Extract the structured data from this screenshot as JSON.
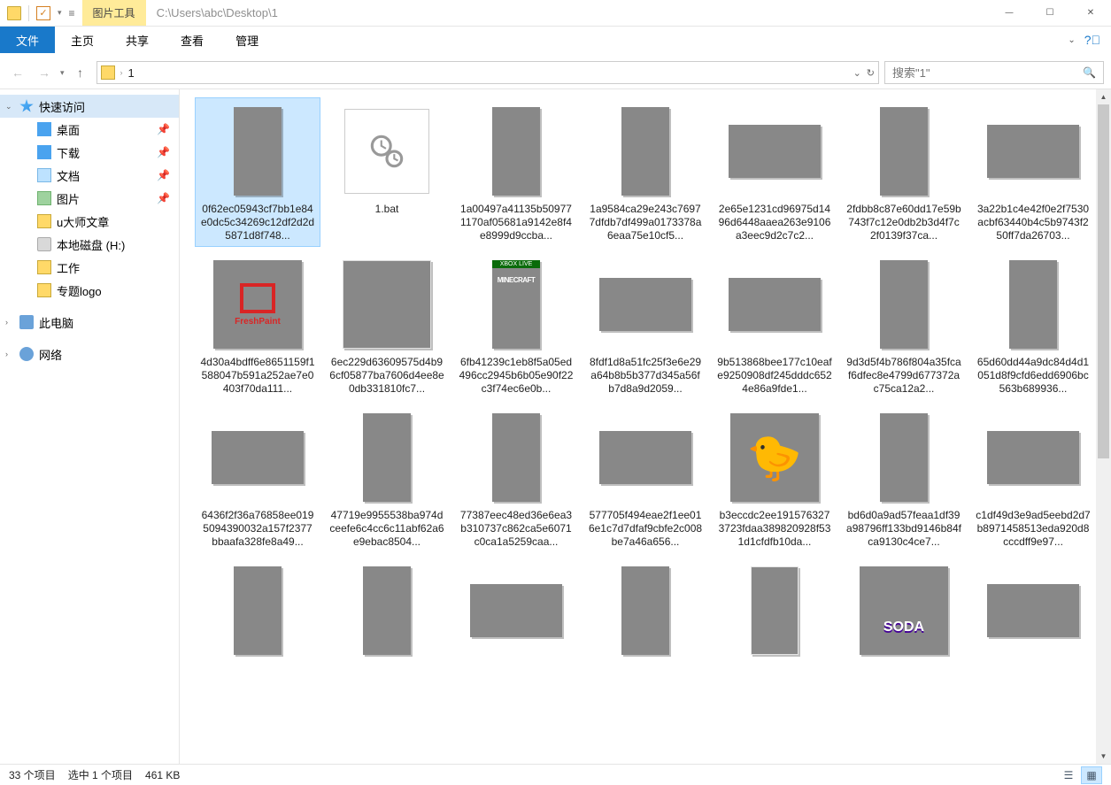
{
  "title_path": "C:\\Users\\abc\\Desktop\\1",
  "context_tab": "图片工具",
  "ribbon": {
    "file": "文件",
    "home": "主页",
    "share": "共享",
    "view": "查看",
    "manage": "管理"
  },
  "breadcrumb": {
    "folder": "1"
  },
  "search": {
    "placeholder": "搜索\"1\""
  },
  "sidebar": {
    "quick": "快速访问",
    "desktop": "桌面",
    "downloads": "下载",
    "documents": "文档",
    "pictures": "图片",
    "udashi": "u大师文章",
    "drive": "本地磁盘 (H:)",
    "work": "工作",
    "logo": "专题logo",
    "pc": "此电脑",
    "network": "网络"
  },
  "items": [
    {
      "name": "0f62ec05943cf7bb1e84e0dc5c34269c12df2d2d5871d8f748...",
      "cls": "g1",
      "shape": "tall",
      "sel": true
    },
    {
      "name": "1.bat",
      "cls": "bat",
      "shape": "bat"
    },
    {
      "name": "1a00497a41135b509771170af05681a9142e8f4e8999d9ccba...",
      "cls": "g2",
      "shape": "tall"
    },
    {
      "name": "1a9584ca29e243c76977dfdb7df499a0173378a6eaa75e10cf5...",
      "cls": "g3",
      "shape": "tall"
    },
    {
      "name": "2e65e1231cd96975d1496d6448aaea263e9106a3eec9d2c7c2...",
      "cls": "g4",
      "shape": "wide"
    },
    {
      "name": "2fdbb8c87e60dd17e59b743f7c12e0db2b3d4f7c2f0139f37ca...",
      "cls": "g5",
      "shape": "tall"
    },
    {
      "name": "3a22b1c4e42f0e2f7530acbf63440b4c5b9743f250ff7da26703...",
      "cls": "g6",
      "shape": "wide"
    },
    {
      "name": "4d30a4bdff6e8651159f1588047b591a252ae7e0403f70da111...",
      "cls": "g7",
      "shape": "sq"
    },
    {
      "name": "6ec229d63609575d4b96cf05877ba7606d4ee8e0db331810fc7...",
      "cls": "g8",
      "shape": "sq"
    },
    {
      "name": "6fb41239c1eb8f5a05ed496cc2945b6b05e90f22c3f74ec6e0b...",
      "cls": "g9",
      "shape": "tall"
    },
    {
      "name": "8fdf1d8a51fc25f3e6e29a64b8b5b377d345a56fb7d8a9d2059...",
      "cls": "g10",
      "shape": "wide"
    },
    {
      "name": "9b513868bee177c10eafe9250908df245dddc6524e86a9fde1...",
      "cls": "g11",
      "shape": "wide"
    },
    {
      "name": "9d3d5f4b786f804a35fcaf6dfec8e4799d677372ac75ca12a2...",
      "cls": "g12",
      "shape": "tall"
    },
    {
      "name": "65d60dd44a9dc84d4d1051d8f9cfd6edd6906bc563b689936...",
      "cls": "g13",
      "shape": "tall"
    },
    {
      "name": "6436f2f36a76858ee0195094390032a157f2377bbaafa328fe8a49...",
      "cls": "g14",
      "shape": "wide"
    },
    {
      "name": "47719e9955538ba974dceefe6c4cc6c11abf62a6e9ebac8504...",
      "cls": "g15",
      "shape": "tall"
    },
    {
      "name": "77387eec48ed36e6ea3b310737c862ca5e6071c0ca1a5259caa...",
      "cls": "g16",
      "shape": "tall"
    },
    {
      "name": "577705f494eae2f1ee016e1c7d7dfaf9cbfe2c008be7a46a656...",
      "cls": "g17",
      "shape": "wide"
    },
    {
      "name": "b3eccdc2ee1915763273723fdaa389820928f531d1cfdfb10da...",
      "cls": "g18",
      "shape": "sq"
    },
    {
      "name": "bd6d0a9ad57feaa1df39a98796ff133bd9146b84fca9130c4ce7...",
      "cls": "g19",
      "shape": "tall"
    },
    {
      "name": "c1df49d3e9ad5eebd2d7b8971458513eda920d8cccdff9e97...",
      "cls": "g20",
      "shape": "wide"
    },
    {
      "name": "",
      "cls": "g21",
      "shape": "tall"
    },
    {
      "name": "",
      "cls": "g22",
      "shape": "tall"
    },
    {
      "name": "",
      "cls": "g23",
      "shape": "wide"
    },
    {
      "name": "",
      "cls": "g24",
      "shape": "tall"
    },
    {
      "name": "",
      "cls": "g25",
      "shape": "tall"
    },
    {
      "name": "",
      "cls": "g26",
      "shape": "sq"
    },
    {
      "name": "",
      "cls": "g27",
      "shape": "wide"
    }
  ],
  "status": {
    "count": "33 个项目",
    "selection": "选中 1 个项目",
    "size": "461 KB"
  }
}
